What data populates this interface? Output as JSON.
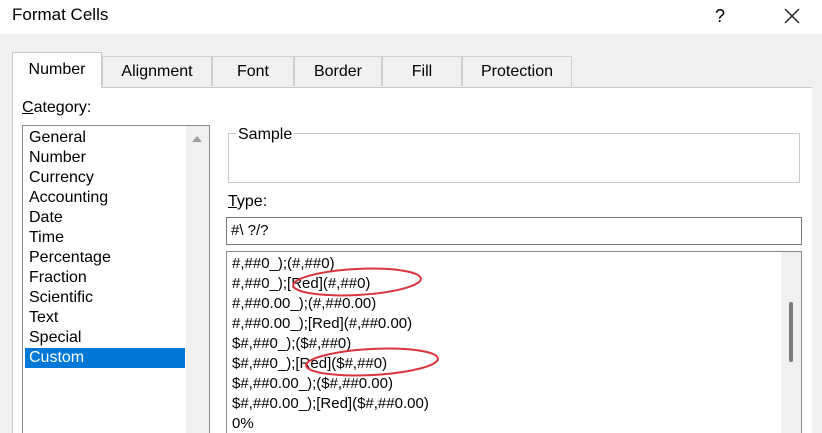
{
  "window": {
    "title": "Format Cells",
    "help_label": "?"
  },
  "tabs": [
    {
      "label": "Number"
    },
    {
      "label": "Alignment"
    },
    {
      "label": "Font"
    },
    {
      "label": "Border"
    },
    {
      "label": "Fill"
    },
    {
      "label": "Protection"
    }
  ],
  "category": {
    "label_first": "C",
    "label_rest": "ategory:",
    "items": [
      "General",
      "Number",
      "Currency",
      "Accounting",
      "Date",
      "Time",
      "Percentage",
      "Fraction",
      "Scientific",
      "Text",
      "Special",
      "Custom"
    ],
    "selected": "Custom"
  },
  "sample": {
    "label": "Sample"
  },
  "type": {
    "label_first": "T",
    "label_rest": "ype:",
    "value": "#\\ ?/?"
  },
  "formats": [
    "#,##0_);(#,##0)",
    "#,##0_);[Red](#,##0)",
    "#,##0.00_);(#,##0.00)",
    "#,##0.00_);[Red](#,##0.00)",
    "$#,##0_);($#,##0)",
    "$#,##0_);[Red]($#,##0)",
    "$#,##0.00_);($#,##0.00)",
    "$#,##0.00_);[Red]($#,##0.00)",
    "0%"
  ],
  "colors": {
    "selection": "#0078d7",
    "annotation": "#d9363e"
  }
}
